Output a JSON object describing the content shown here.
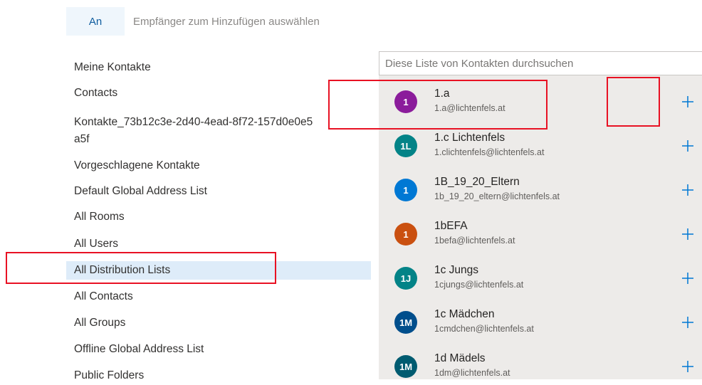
{
  "recipient": {
    "to_label": "An",
    "hint": "Empfänger zum Hinzufügen auswählen"
  },
  "address_books": [
    {
      "label": "Meine Kontakte"
    },
    {
      "label": "Contacts"
    },
    {
      "label": "Kontakte_73b12c3e-2d40-4ead-8f72-157d0e0e5a5f"
    },
    {
      "label": "Vorgeschlagene Kontakte"
    },
    {
      "label": "Default Global Address List"
    },
    {
      "label": "All Rooms"
    },
    {
      "label": "All Users"
    },
    {
      "label": "All Distribution Lists",
      "selected": true
    },
    {
      "label": "All Contacts"
    },
    {
      "label": "All Groups"
    },
    {
      "label": "Offline Global Address List"
    },
    {
      "label": "Public Folders"
    }
  ],
  "search": {
    "placeholder": "Diese Liste von Kontakten durchsuchen"
  },
  "contacts": [
    {
      "initials": "1",
      "name": "1.a",
      "email": "1.a@lichtenfels.at",
      "color": "#8b1c9b"
    },
    {
      "initials": "1L",
      "name": "1.c Lichtenfels",
      "email": "1.clichtenfels@lichtenfels.at",
      "color": "#038387"
    },
    {
      "initials": "1",
      "name": "1B_19_20_Eltern",
      "email": "1b_19_20_eltern@lichtenfels.at",
      "color": "#0078d4"
    },
    {
      "initials": "1",
      "name": "1bEFA",
      "email": "1befa@lichtenfels.at",
      "color": "#ca5010"
    },
    {
      "initials": "1J",
      "name": "1c Jungs",
      "email": "1cjungs@lichtenfels.at",
      "color": "#038387"
    },
    {
      "initials": "1M",
      "name": "1c Mädchen",
      "email": "1cmdchen@lichtenfels.at",
      "color": "#004e8c"
    },
    {
      "initials": "1M",
      "name": "1d Mädels",
      "email": "1dm@lichtenfels.at",
      "color": "#005b70"
    }
  ],
  "colors": {
    "accent": "#0078d4",
    "selected_bg": "#deecf9",
    "panel_bg": "#edebe9",
    "highlight": "#e81123"
  },
  "icons": {
    "add": "plus-icon"
  }
}
